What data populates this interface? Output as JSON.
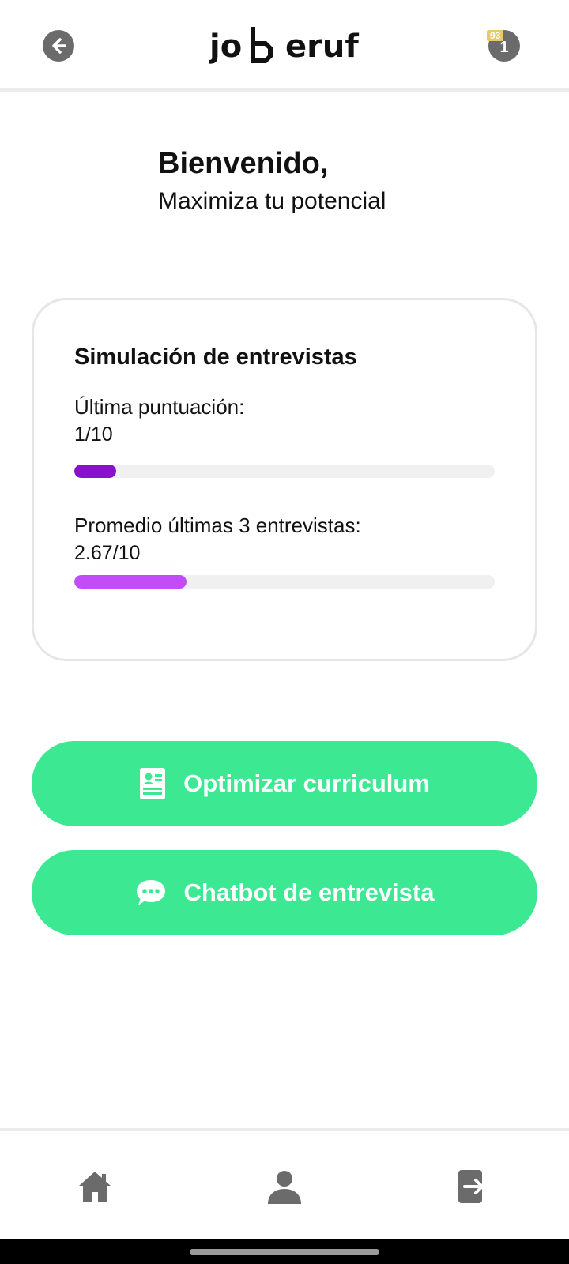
{
  "header": {
    "logo_text": "jo b eruf",
    "battery_percent": "93",
    "notification_count": "1"
  },
  "welcome": {
    "title": "Bienvenido,",
    "subtitle": "Maximiza tu potencial"
  },
  "card": {
    "title": "Simulación de entrevistas",
    "metrics": [
      {
        "label": "Última puntuación:",
        "value_text": "1/10",
        "progress_fraction": 0.1,
        "color": "#8a10d0"
      },
      {
        "label": "Promedio últimas 3 entrevistas:",
        "value_text": "2.67/10",
        "progress_fraction": 0.267,
        "color": "#c24cf7"
      }
    ]
  },
  "actions": [
    {
      "label": "Optimizar curriculum",
      "icon": "resume-icon"
    },
    {
      "label": "Chatbot de entrevista",
      "icon": "chat-bubble-icon"
    }
  ],
  "bottom_nav": {
    "items": [
      {
        "icon": "home-icon"
      },
      {
        "icon": "profile-icon"
      },
      {
        "icon": "logout-icon"
      }
    ]
  },
  "colors": {
    "accent": "#3de893",
    "icon_gray": "#6b6b6b"
  }
}
